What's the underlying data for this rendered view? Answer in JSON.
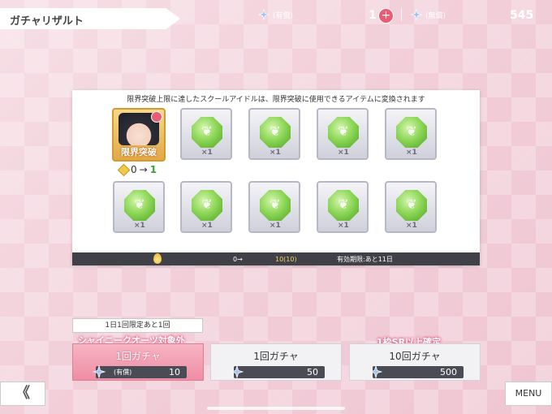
{
  "header": {
    "title": "ガチャリザルト",
    "currency_paid_label": "(有償)",
    "currency_paid_count": "1",
    "currency_free_label": "(無償)",
    "currency_free_count": "545"
  },
  "panel": {
    "notice": "限界突破上限に達したスクールアイドルは、限界突破に使用できるアイテムに変換されます",
    "idol_card": {
      "limit_label": "限界突破",
      "progress_from": "0",
      "progress_arrow": "→",
      "progress_to": "1"
    },
    "item_quantity": "×1",
    "footer": {
      "from": "0→",
      "to": "10(10)",
      "expiry": "有効期限:あと11日"
    }
  },
  "gacha": {
    "daily_limit_tag": "1日1回限定あと1回",
    "buttons": [
      {
        "banner": "シャイニークオーツ対象外",
        "title": "1回ガチャ",
        "tag": "(有償)",
        "cost": "10"
      },
      {
        "banner": "",
        "title": "1回ガチャ",
        "tag": "",
        "cost": "50"
      },
      {
        "banner": "1枠SR以上確定",
        "title": "10回ガチャ",
        "tag": "",
        "cost": "500"
      }
    ]
  },
  "nav": {
    "back_label": "《",
    "menu_label": "MENU"
  },
  "colors": {
    "accent_pink": "#e85d74",
    "gem_green": "#8fd85a",
    "dark_bar": "#3f4048"
  },
  "icons": {
    "currency": "star-gem-icon",
    "item": "green-feather-gem-icon",
    "drop": "gold-drop-icon"
  }
}
